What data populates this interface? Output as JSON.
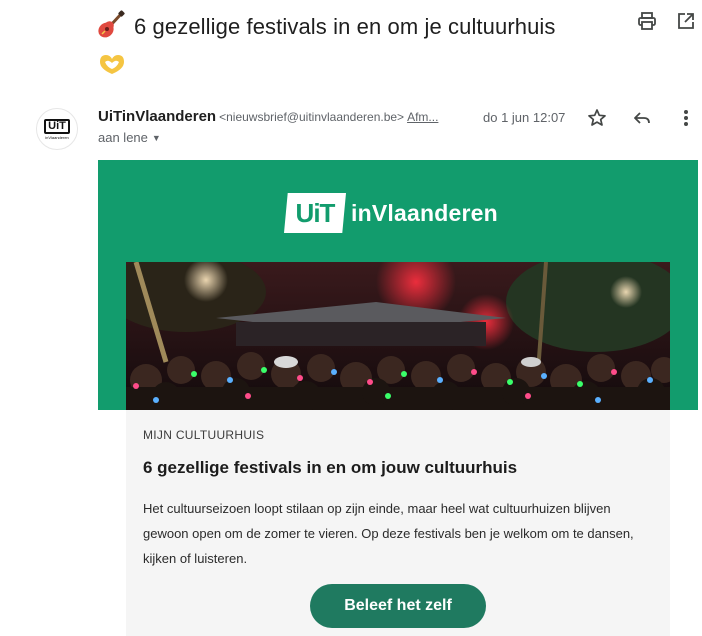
{
  "subject": {
    "title": "6 gezellige festivals in en om je cultuurhuis",
    "emoji_leading": "guitar-icon",
    "emoji_trailing": "heart-hands-icon"
  },
  "toolbar": {
    "print_icon": "print-icon",
    "popout_icon": "open-in-new-window-icon"
  },
  "sender": {
    "avatar_main": "UiT",
    "avatar_sub": "inVlaanderen",
    "name": "UiTinVlaanderen",
    "email": "<nieuwsbrief@uitinvlaanderen.be>",
    "unsubscribe": "Afm...",
    "date": "do 1 jun 12:07",
    "recipient": "aan lene"
  },
  "newsletter": {
    "logo_box": "UiT",
    "logo_text": "inVlaanderen",
    "eyebrow": "MIJN CULTUURHUIS",
    "title": "6 gezellige festivals in en om jouw cultuurhuis",
    "body": "Het cultuurseizoen loopt stilaan op zijn einde, maar heel wat cultuurhuizen blijven gewoon open om de zomer te vieren. Op deze festivals ben je welkom om te dansen, kijken of luisteren.",
    "cta": "Beleef het zelf"
  },
  "colors": {
    "brand_green": "#129c6d",
    "cta_green": "#1f7a60",
    "card_bg": "#f5f5f5"
  }
}
